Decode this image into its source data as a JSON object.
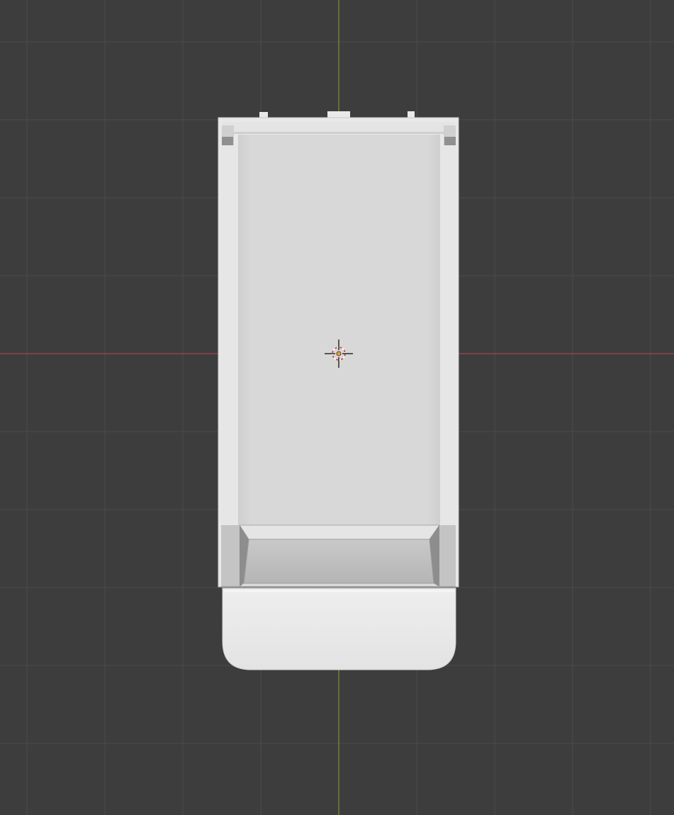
{
  "viewport": {
    "view": "top-orthographic",
    "background_color": "#3d3d3d",
    "grid_color": "#4a4a4a",
    "x_axis_color": "#a7434f",
    "y_axis_color": "#7d9430"
  },
  "scene": {
    "object": {
      "icon": "mesh-object",
      "base_color": "#e6e7e6",
      "inner_panel_color": "#d6d7d6",
      "tray_color": "#b9bab9",
      "selected": false
    },
    "cursor": {
      "icon": "3d-cursor-icon",
      "ring_colors": [
        "#d23c3c",
        "#ffffff"
      ]
    }
  }
}
